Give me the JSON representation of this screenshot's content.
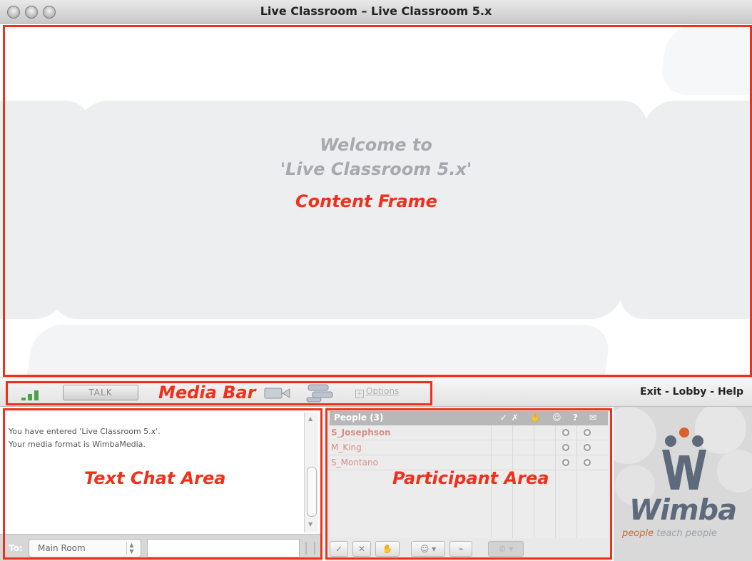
{
  "window": {
    "title": "Live Classroom – Live Classroom 5.x"
  },
  "content_frame": {
    "welcome_line1": "Welcome to",
    "welcome_line2": "'Live Classroom 5.x'"
  },
  "media_bar": {
    "talk_label": "TALK",
    "options_label": "Options",
    "icons": [
      "signal-strength-icon",
      "video-icon",
      "hand-raise-icon",
      "options-icon"
    ]
  },
  "nav": {
    "exit": "Exit",
    "lobby": "Lobby",
    "help": "Help",
    "separator": "-"
  },
  "chat": {
    "messages": [
      "You have entered 'Live Classroom 5.x'.",
      "Your media format is WimbaMedia."
    ],
    "to_label": "To:",
    "room": "Main Room"
  },
  "participants": {
    "header": "People (3)",
    "header_icons": "✓✗ ✋ ☺ ? ✉",
    "people": [
      {
        "name": "S_Josephson",
        "bold": true
      },
      {
        "name": "M_King",
        "bold": false
      },
      {
        "name": "S_Montano",
        "bold": false
      }
    ],
    "toolbar": [
      "✓",
      "✕",
      "✋",
      "☺ ▾",
      "⌁",
      "⚙ ▾"
    ]
  },
  "logo": {
    "brand": "Wimba",
    "tagline_accent": "people",
    "tagline_rest": "teach people"
  },
  "annotations": {
    "content_frame": "Content Frame",
    "media_bar": "Media Bar",
    "text_chat_area": "Text Chat Area",
    "participant_area": "Participant Area"
  },
  "colors": {
    "annotation_red": "#f0301a",
    "welcome_gray": "#a6a9ae",
    "participant_name": "#d98c86",
    "signal_green": "#4aa54a",
    "logo_blue": "#5d6a7c",
    "logo_orange": "#d9602f"
  }
}
